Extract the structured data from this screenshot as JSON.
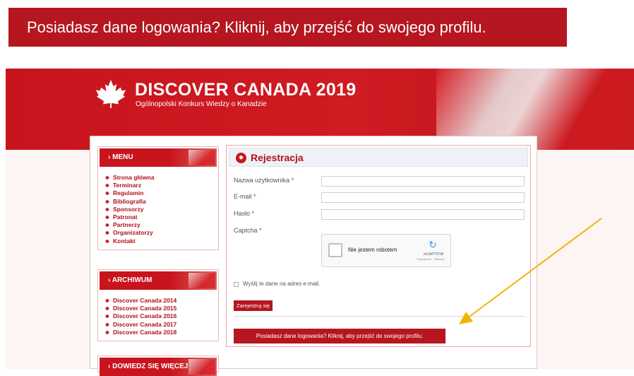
{
  "banner": {
    "text": "Posiadasz dane logowania? Kliknij, aby przejść do swojego profilu."
  },
  "header": {
    "title": "DISCOVER CANADA 2019",
    "subtitle": "Ogólnopolski Konkurs Wiedzy o Kanadzie"
  },
  "sidebar": {
    "menu": {
      "heading": "› MENU",
      "items": [
        "Strona główna",
        "Terminarz",
        "Regulamin",
        "Bibliografia",
        "Sponsorzy",
        "Patronat",
        "Partnerzy",
        "Organizatorzy",
        "Kontakt"
      ]
    },
    "archive": {
      "heading": "› ARCHIWUM",
      "items": [
        "Discover Canada 2014",
        "Discover Canada 2015",
        "Discover Canada 2016",
        "Discover Canada 2017",
        "Discover Canada 2018"
      ]
    },
    "more": {
      "heading": "› DOWIEDZ SIĘ WIĘCEJ"
    }
  },
  "form": {
    "title": "Rejestracja",
    "username_label": "Nazwa użytkownika",
    "email_label": "E-mail",
    "password_label": "Hasło",
    "captcha_label": "Captcha",
    "required_mark": "*",
    "captcha": {
      "text": "Nie jestem robotem",
      "brand": "reCAPTCHA",
      "terms": "Prywatność - Warunki"
    },
    "send_copy_label": "Wyślij te dane na adres e-mail.",
    "register_button": "Zarejestruj się",
    "login_button": "Posiadasz dane logowania? Kliknij, aby przejść do swojego profilu."
  },
  "colors": {
    "brand_red": "#b5161f",
    "arrow": "#f0b400"
  }
}
